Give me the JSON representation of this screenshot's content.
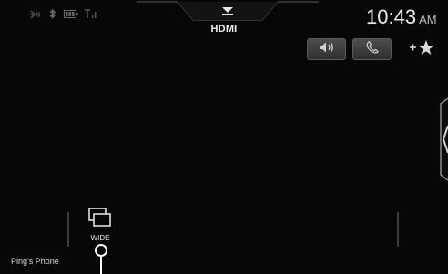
{
  "status": {
    "icons": [
      "bluetooth-audio-icon",
      "bluetooth-icon",
      "battery-icon",
      "signal-icon"
    ],
    "signal_text": "Tıl"
  },
  "source": {
    "label": "HDMI"
  },
  "clock": {
    "time": "10:43",
    "ampm": "AM"
  },
  "quick_buttons": [
    {
      "icon": "speaker-volume-icon"
    },
    {
      "icon": "phone-icon"
    }
  ],
  "favorite_add": {
    "icon": "add-favorite-star-icon"
  },
  "bottom_bar": {
    "wide_label": "WIDE",
    "wide_icon": "screen-mode-icon",
    "phone_name": "Ping's Phone"
  },
  "colors": {
    "background": "#070707",
    "button": "#3e3e3e",
    "text": "#e6e6e6"
  }
}
